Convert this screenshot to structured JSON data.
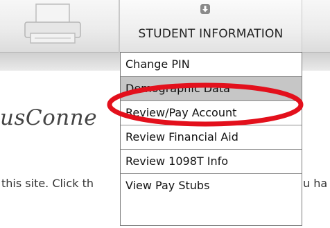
{
  "nav": {
    "active_tab_label": "STUDENT INFORMATION",
    "active_tab_icon": "down-arrow-icon",
    "left_tab_icon": "printer-icon"
  },
  "page": {
    "brand_fragment": "usConne",
    "body_text_fragment": "this site. Click th",
    "body_text_fragment_right": "u ha"
  },
  "menu": {
    "items": [
      {
        "label": "Change PIN"
      },
      {
        "label": "Demographic Data"
      },
      {
        "label": "Review/Pay Account"
      },
      {
        "label": "Review Financial Aid"
      },
      {
        "label": "Review 1098T Info"
      },
      {
        "label": "View Pay Stubs"
      }
    ],
    "selected_index": 1
  },
  "annotation": {
    "color": "#e3101c",
    "target": "Demographic Data"
  }
}
